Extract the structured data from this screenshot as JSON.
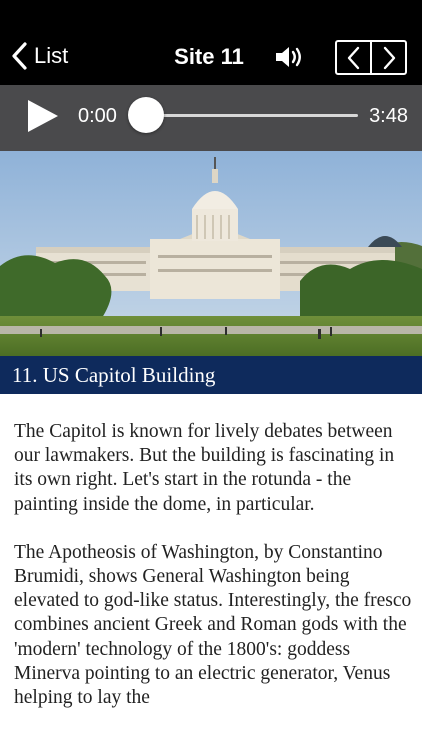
{
  "nav": {
    "back_label": "List",
    "title": "Site 11"
  },
  "player": {
    "current_time": "0:00",
    "duration": "3:48",
    "progress": 0
  },
  "site": {
    "caption": "11. US Capitol Building",
    "paragraphs": [
      "The Capitol is known for lively debates between our lawmakers. But the building is fascinating in its own right. Let's start in the rotunda - the painting inside the dome, in particular.",
      "The Apotheosis of Washington, by Constantino Brumidi, shows General Washington being elevated to god-like status. Interestingly, the fresco combines ancient Greek and Roman gods with the 'modern' technology of the 1800's: goddess Minerva pointing to an electric generator, Venus helping to lay the"
    ]
  },
  "icons": {
    "back": "chevron-left-icon",
    "speaker": "speaker-volume-icon",
    "prev": "chevron-left-icon",
    "next": "chevron-right-icon",
    "play": "play-icon"
  },
  "colors": {
    "navbar": "#000000",
    "player": "#4a4a4c",
    "caption_bar": "#0e2a5c"
  }
}
